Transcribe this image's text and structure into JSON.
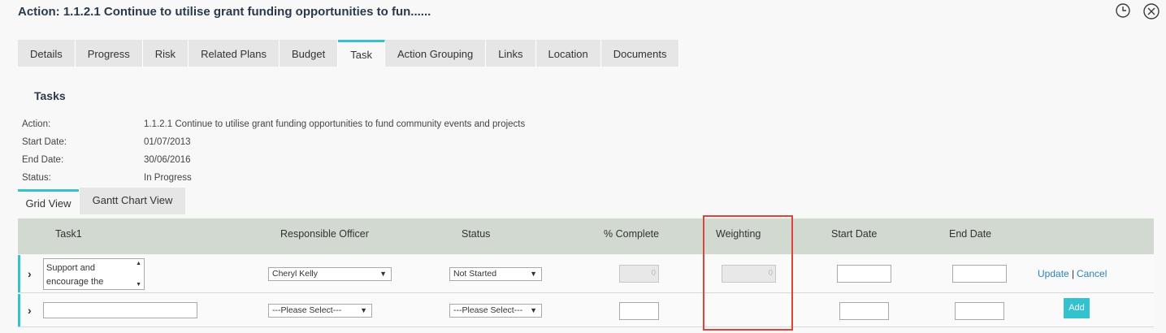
{
  "header": {
    "title": "Action: 1.1.2.1 Continue to utilise grant funding opportunities to fun......",
    "icons": [
      "history-icon",
      "close-icon"
    ]
  },
  "tabs": [
    "Details",
    "Progress",
    "Risk",
    "Related Plans",
    "Budget",
    "Task",
    "Action Grouping",
    "Links",
    "Location",
    "Documents"
  ],
  "active_tab": "Task",
  "section": {
    "title": "Tasks"
  },
  "info": {
    "action_label": "Action:",
    "action_value": "1.1.2.1 Continue to utilise grant funding opportunities to fund community events and projects",
    "start_label": "Start Date:",
    "start_value": "01/07/2013",
    "end_label": "End Date:",
    "end_value": "30/06/2016",
    "status_label": "Status:",
    "status_value": "In Progress"
  },
  "views": {
    "grid": "Grid View",
    "gantt": "Gantt Chart View",
    "active": "Grid View"
  },
  "grid": {
    "columns": {
      "task": "Task1",
      "officer": "Responsible Officer",
      "status": "Status",
      "complete": "% Complete",
      "weighting": "Weighting",
      "start": "Start Date",
      "end": "End Date"
    },
    "row1": {
      "task_line1": "Support and",
      "task_line2": "encourage the",
      "officer": "Cheryl Kelly",
      "status": "Not Started",
      "complete": "0",
      "weighting": "0",
      "update": "Update",
      "separator": "|",
      "cancel": "Cancel"
    },
    "row2": {
      "officer": "---Please Select---",
      "status": "---Please Select---",
      "add": "Add"
    }
  },
  "colors": {
    "accent": "#34c3ce",
    "highlight": "#e04438",
    "header_bg": "#d2d9d0"
  }
}
